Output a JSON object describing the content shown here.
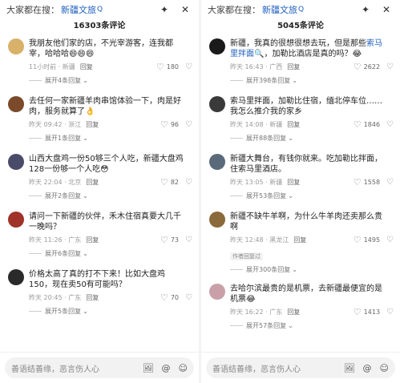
{
  "left": {
    "topbar": {
      "prefix": "大家都在搜：",
      "keyword": "新疆文旅",
      "suffix": "Q"
    },
    "count_title": "16303条评论",
    "comments": [
      {
        "text": "我朋友他们家的店，不光宰游客，连我都宰，哈哈哈😄😄😄",
        "time": "11小时前 · 新疆",
        "reply": "回复",
        "likes": "180",
        "expand": "展开4条回复"
      },
      {
        "text": "去任何一家新疆羊肉串馆体验一下，肉是好肉，服务就算了👌",
        "time": "昨天 09:42 · 浙江",
        "reply": "回复",
        "likes": "96",
        "expand": "展开1条回复"
      },
      {
        "text": "山西大盘鸡一份50够三个人吃，新疆大盘鸡128一份够一个人吃😳",
        "time": "昨天 22:04 · 北京",
        "reply": "回复",
        "likes": "82",
        "expand": "展开2条回复"
      },
      {
        "text": "请问一下新疆的伙伴，禾木住宿真要大几千一晚吗？",
        "time": "昨天 11:26 · 广东",
        "reply": "回复",
        "likes": "73",
        "expand": "展开6条回复"
      },
      {
        "text": "价格太高了真的打不下来！比如大盘鸡150，现在卖50有可能吗？",
        "time": "昨天 20:45 · 广东",
        "reply": "回复",
        "likes": "70",
        "expand": "展开5条回复"
      }
    ],
    "input": {
      "placeholder": "善语结善缘，恶言伤人心",
      "icons": [
        "🖼",
        "@",
        "☺"
      ]
    }
  },
  "right": {
    "topbar": {
      "prefix": "大家都在搜：",
      "keyword": "新疆文旅",
      "suffix": "Q"
    },
    "count_title": "5045条评论",
    "comments": [
      {
        "text_before": "新疆，我真的很想很想去玩，但是那些",
        "highlight": "索马里拌面",
        "text_after": "🔍，加勒比酒店是真的吗？😂",
        "time": "昨天 16:43 · 广西",
        "reply": "回复",
        "likes": "2622",
        "expand": "展开398条回复"
      },
      {
        "text": "索马里拌面，加勒比住宿，缅北停车位……我怎么推介我的家乡",
        "time": "昨天 14:08 · 新疆",
        "reply": "回复",
        "likes": "1846",
        "expand": "展开88条回复"
      },
      {
        "text": "新疆大舞台，有钱你就来。吃加勒比拌面，住索马里酒店。",
        "time": "昨天 13:05 · 新疆",
        "reply": "回复",
        "likes": "1558",
        "expand": "展开53条回复"
      },
      {
        "text": "新疆不缺牛羊啊，为什么牛羊肉还卖那么贵啊",
        "time": "昨天 12:48 · 黑龙江",
        "reply": "回复",
        "likes": "1495",
        "author_tag": "作者回复过",
        "expand": "展开300条回复"
      },
      {
        "text": "去哈尔滨最贵的是机票，去新疆最便宜的是机票😂",
        "time": "昨天 16:22 · 广东",
        "reply": "回复",
        "likes": "1413",
        "expand": "展开57条回复"
      }
    ],
    "input": {
      "placeholder": "善语结善缘，恶言伤人心",
      "icons": [
        "🖼",
        "@",
        "☺"
      ]
    }
  },
  "icons": {
    "share": "✦",
    "close": "✕",
    "heart": "♡",
    "dislike": "♡"
  },
  "colors": {
    "keyword": "#1f5fbf",
    "meta": "#9a9a9a"
  }
}
